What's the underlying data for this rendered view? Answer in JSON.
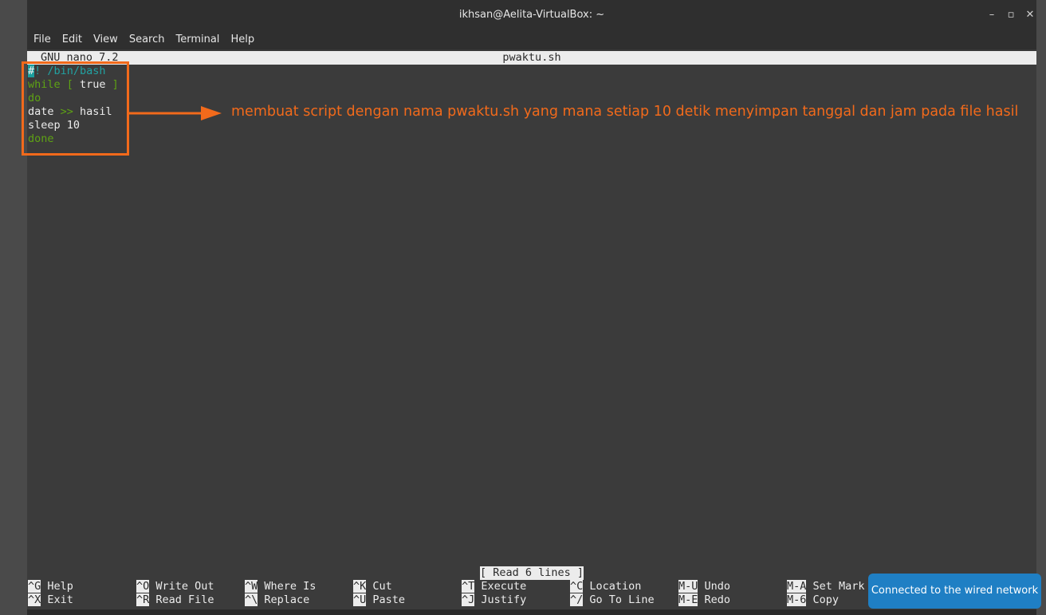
{
  "window": {
    "title": "ikhsan@Aelita-VirtualBox: ~",
    "controls": {
      "minimize": "–",
      "maximize": "▫",
      "close": "✕"
    }
  },
  "menu": [
    "File",
    "Edit",
    "View",
    "Search",
    "Terminal",
    "Help"
  ],
  "nano": {
    "version": "GNU nano 7.2",
    "filename": "pwaktu.sh",
    "status": "[ Read 6 lines ]",
    "code_lines": [
      {
        "cursor": "#",
        "rest": "! /bin/bash"
      },
      {
        "kw": "while",
        "b1": " [ ",
        "word": "true",
        "b2": " ]"
      },
      {
        "text": "do"
      },
      {
        "a": "date ",
        "op": ">>",
        "b": " hasil"
      },
      {
        "text": "sleep 10"
      },
      {
        "text": "done"
      }
    ],
    "shortcuts": [
      {
        "key": "^G",
        "label": "Help"
      },
      {
        "key": "^X",
        "label": "Exit"
      },
      {
        "key": "^O",
        "label": "Write Out"
      },
      {
        "key": "^R",
        "label": "Read File"
      },
      {
        "key": "^W",
        "label": "Where Is"
      },
      {
        "key": "^\\",
        "label": "Replace"
      },
      {
        "key": "^K",
        "label": "Cut"
      },
      {
        "key": "^U",
        "label": "Paste"
      },
      {
        "key": "^T",
        "label": "Execute"
      },
      {
        "key": "^J",
        "label": "Justify"
      },
      {
        "key": "^C",
        "label": "Location"
      },
      {
        "key": "^/",
        "label": "Go To Line"
      },
      {
        "key": "M-U",
        "label": "Undo"
      },
      {
        "key": "M-E",
        "label": "Redo"
      },
      {
        "key": "M-A",
        "label": "Set Mark"
      },
      {
        "key": "M-6",
        "label": "Copy"
      }
    ]
  },
  "annotation": {
    "text": "membuat script dengan nama pwaktu.sh yang mana setiap 10 detik menyimpan tanggal dan jam pada file hasil",
    "color": "#f26a1b"
  },
  "notification": {
    "text": "Connected to the wired network",
    "color": "#1f7fc4"
  }
}
